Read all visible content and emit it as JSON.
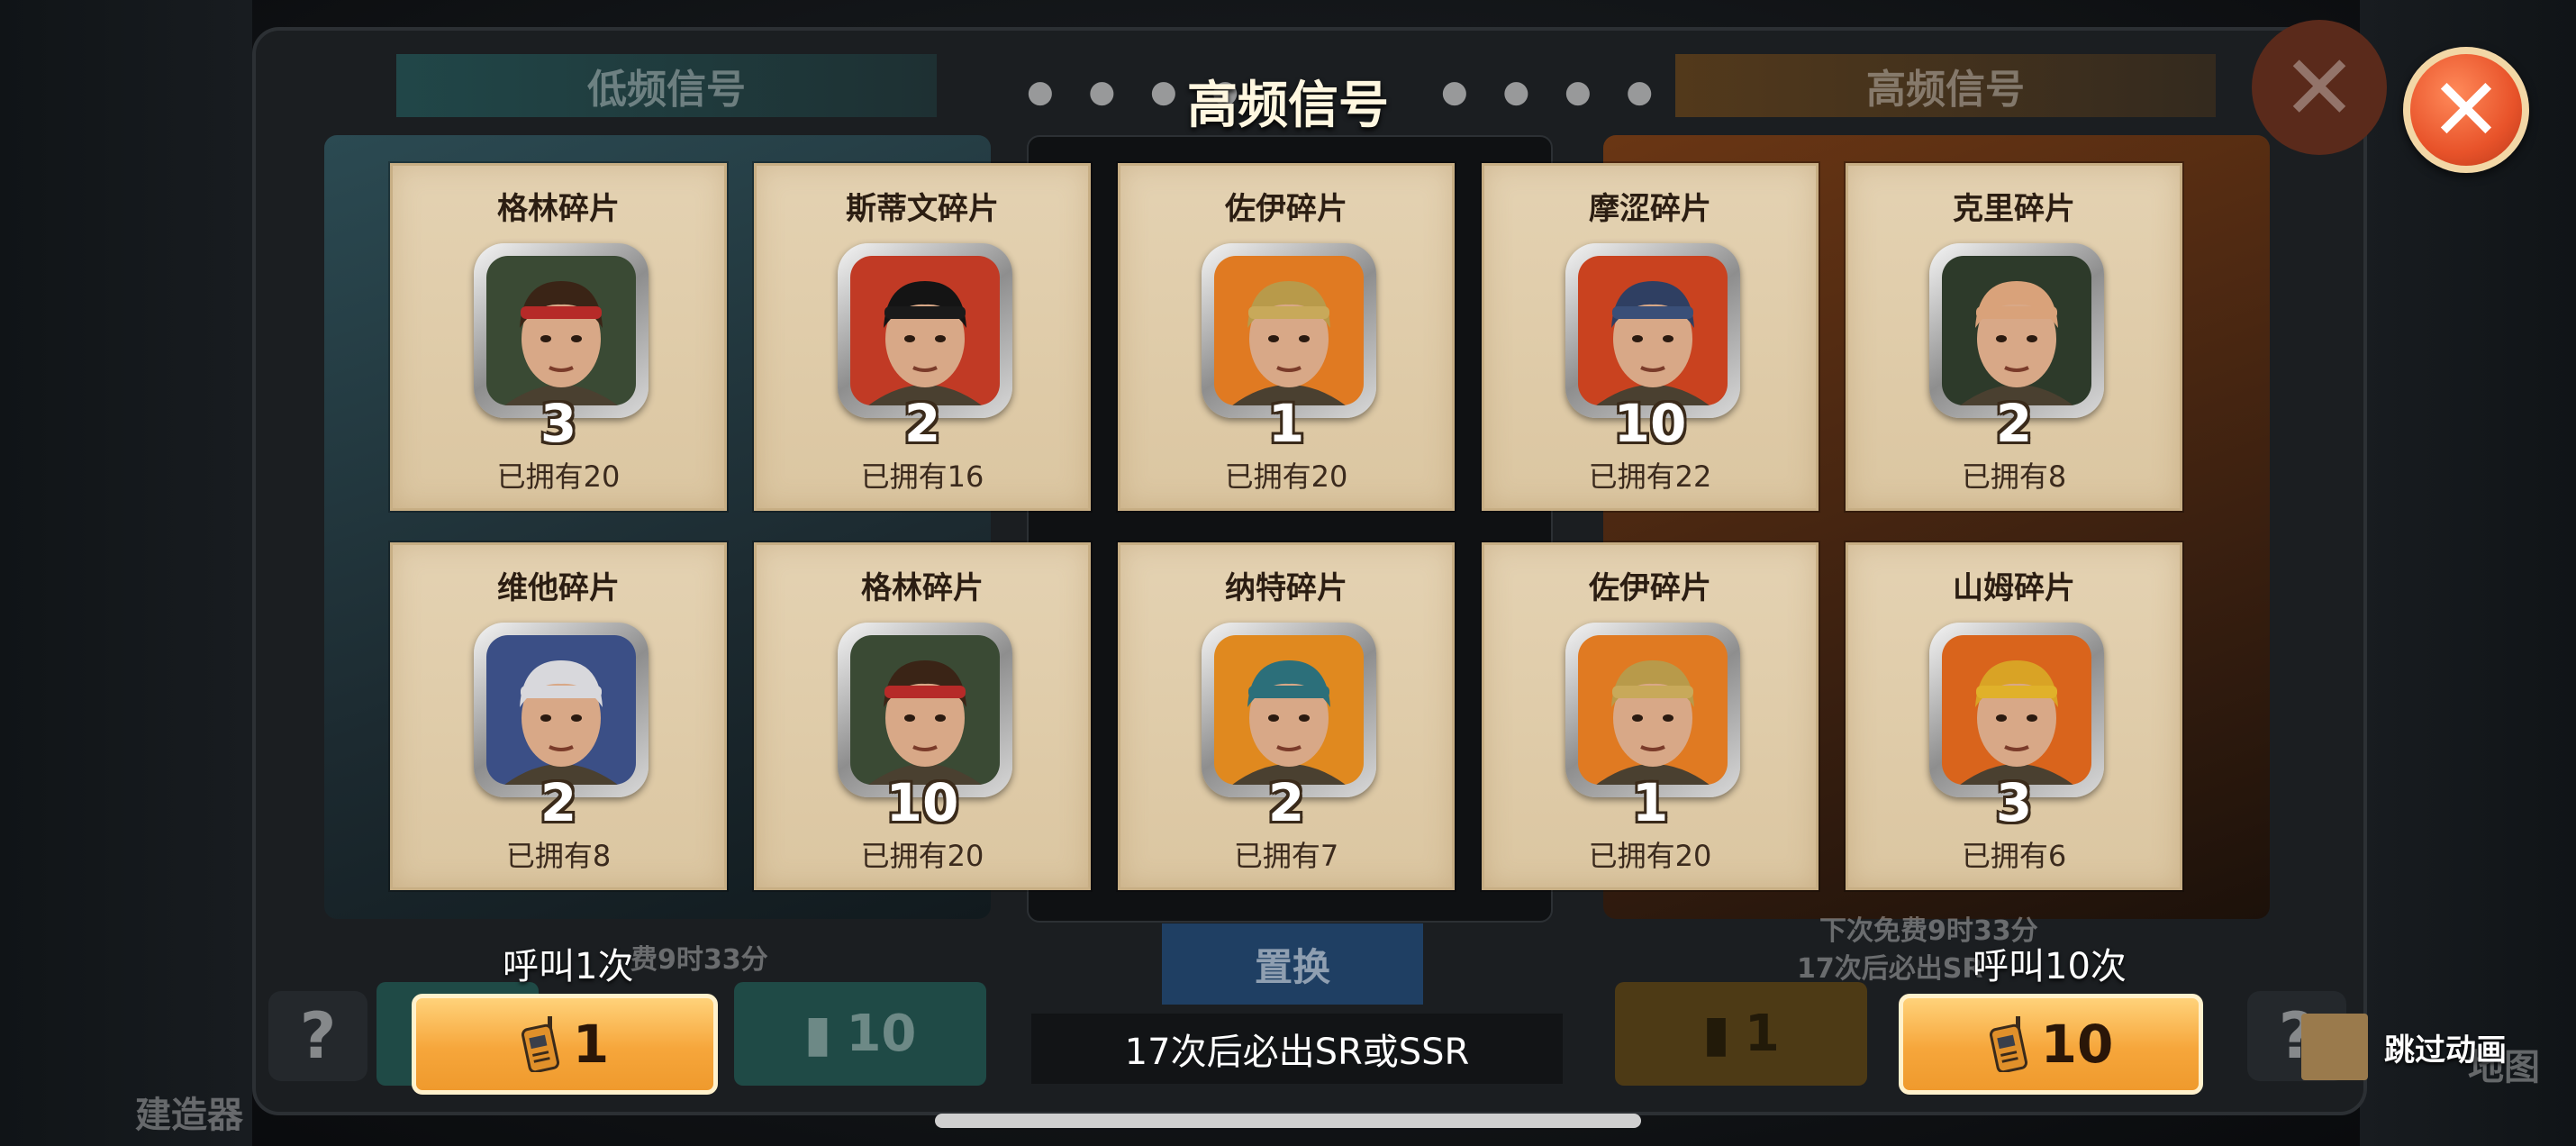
{
  "background": {
    "tab_left": "低频信号",
    "tab_right": "高频信号",
    "free_left": "费9时33分",
    "free_right_line1": "下次免费9时33分",
    "free_right_line2": "17次后必出SR",
    "swap_label": "置换",
    "builder_label": "建造器",
    "map_label": "地图",
    "btn_teal_count": "10",
    "btn_gold_count": "1"
  },
  "popup": {
    "title": "高频信号",
    "cards": [
      {
        "name": "格林碎片",
        "count": "3",
        "owned": "已拥有20",
        "hair": "#3a2416",
        "band": "#b62a28",
        "bg": "#3a4a34"
      },
      {
        "name": "斯蒂文碎片",
        "count": "2",
        "owned": "已拥有16",
        "hair": "#141414",
        "band": "#1a1a1a",
        "bg": "#c13a25"
      },
      {
        "name": "佐伊碎片",
        "count": "1",
        "owned": "已拥有20",
        "hair": "#b89a4a",
        "band": "#c8a95a",
        "bg": "#e07a22"
      },
      {
        "name": "摩涩碎片",
        "count": "10",
        "owned": "已拥有22",
        "hair": "#2f3f62",
        "band": "#3a4f78",
        "bg": "#c9421f"
      },
      {
        "name": "克里碎片",
        "count": "2",
        "owned": "已拥有8",
        "hair": "#d9a27a",
        "band": "#d9a27a",
        "bg": "#2d3a2a"
      },
      {
        "name": "维他碎片",
        "count": "2",
        "owned": "已拥有8",
        "hair": "#d8d8dc",
        "band": "#d8d8dc",
        "bg": "#3b4f86"
      },
      {
        "name": "格林碎片",
        "count": "10",
        "owned": "已拥有20",
        "hair": "#3a2416",
        "band": "#b62a28",
        "bg": "#3a4a34"
      },
      {
        "name": "纳特碎片",
        "count": "2",
        "owned": "已拥有7",
        "hair": "#2c6f7a",
        "band": "#2c6f7a",
        "bg": "#e0891f"
      },
      {
        "name": "佐伊碎片",
        "count": "1",
        "owned": "已拥有20",
        "hair": "#b89a4a",
        "band": "#c8a95a",
        "bg": "#e07a22"
      },
      {
        "name": "山姆碎片",
        "count": "3",
        "owned": "已拥有6",
        "hair": "#d9a325",
        "band": "#e0b12a",
        "bg": "#d9641c"
      }
    ],
    "call_one_label": "呼叫1次",
    "call_one_count": "1",
    "call_ten_label": "呼叫10次",
    "call_ten_count": "10",
    "pity_text": "17次后必出SR或SSR",
    "skip_label": "跳过动画"
  },
  "colors": {
    "close_button": "#e8532a",
    "call_button": "#f6a63b",
    "card_bg": "#e4d2b2"
  }
}
